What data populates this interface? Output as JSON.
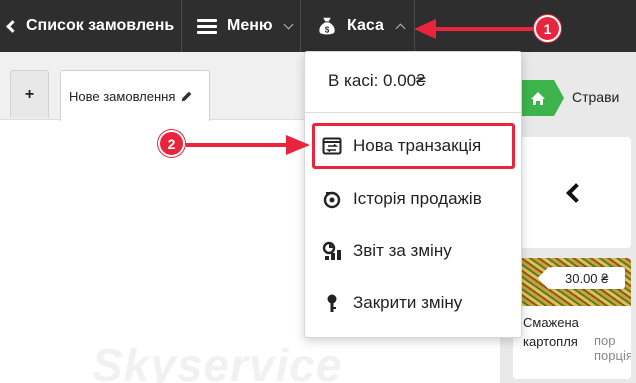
{
  "topbar": {
    "orders_label": "Список замовлень",
    "menu_label": "Меню",
    "kasa_label": "Каса"
  },
  "tabs": {
    "add_label": "+",
    "order_label": "Нове замовлення"
  },
  "watermark": "Skyservice",
  "right_panel": {
    "breadcrumb_label": "Страви",
    "product": {
      "price": "30.00 ₴",
      "name": "Смажена картопля",
      "unit": "пор порція"
    }
  },
  "kasa_menu": {
    "balance": "В касі: 0.00₴",
    "items": [
      {
        "label": "Нова транзакція",
        "icon": "transaction-icon"
      },
      {
        "label": "Історія продажів",
        "icon": "history-icon"
      },
      {
        "label": "Звіт за зміну",
        "icon": "shift-report-icon"
      },
      {
        "label": "Закрити зміну",
        "icon": "key-icon"
      }
    ]
  },
  "annotations": {
    "step1": "1",
    "step2": "2"
  },
  "colors": {
    "topbar": "#2e2e2e",
    "accent_green": "#3cb44b",
    "annotation_red": "#e8253c"
  }
}
